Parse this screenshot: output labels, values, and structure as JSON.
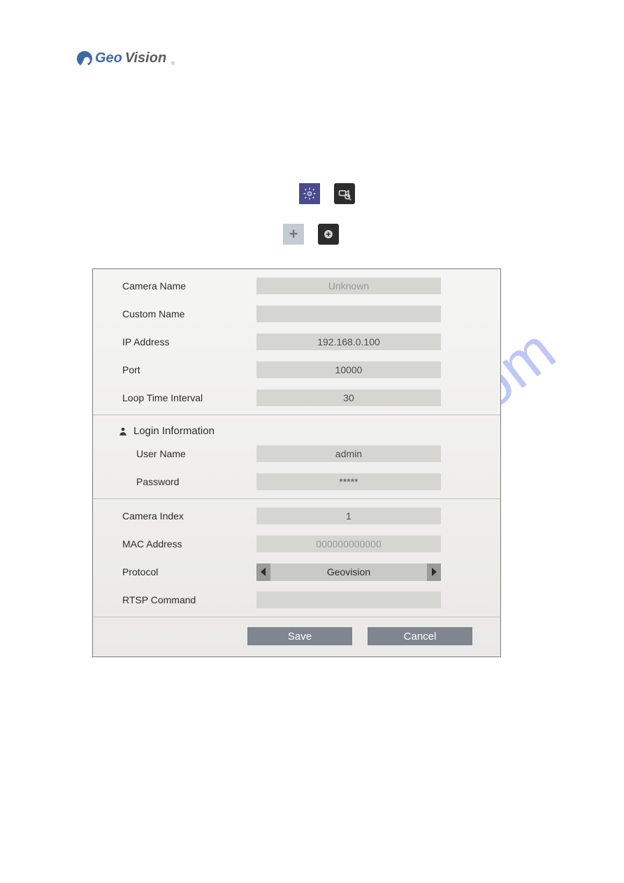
{
  "logo": {
    "part1": "Geo",
    "part2": "Vision",
    "reg": "®"
  },
  "icons": {
    "settings": "settings-icon",
    "camsearch": "camera-search-icon",
    "plus": "+",
    "addcam": "add-camera-icon"
  },
  "form": {
    "camera_name": {
      "label": "Camera Name",
      "value": "Unknown"
    },
    "custom_name": {
      "label": "Custom Name",
      "value": ""
    },
    "ip_address": {
      "label": "IP Address",
      "value": "192.168.0.100"
    },
    "port": {
      "label": "Port",
      "value": "10000"
    },
    "loop_interval": {
      "label": "Loop Time Interval",
      "value": "30"
    },
    "login_header": "Login Information",
    "user_name": {
      "label": "User Name",
      "value": "admin"
    },
    "password": {
      "label": "Password",
      "value": "*****"
    },
    "camera_index": {
      "label": "Camera Index",
      "value": "1"
    },
    "mac_address": {
      "label": "MAC Address",
      "value": "000000000000"
    },
    "protocol": {
      "label": "Protocol",
      "value": "Geovision"
    },
    "rtsp_command": {
      "label": "RTSP Command",
      "value": ""
    }
  },
  "buttons": {
    "save": "Save",
    "cancel": "Cancel"
  },
  "watermark": "manualshive.com"
}
